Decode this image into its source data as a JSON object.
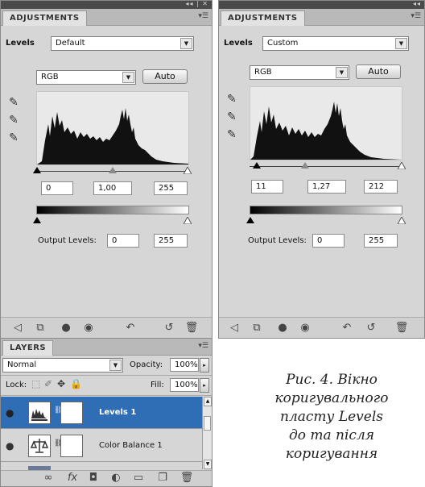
{
  "left_panel": {
    "tab": "ADJUSTMENTS",
    "preset_label": "Levels",
    "preset_value": "Default",
    "channel": "RGB",
    "auto_label": "Auto",
    "input_black": "0",
    "input_gamma": "1,00",
    "input_white": "255",
    "output_label": "Output Levels:",
    "output_black": "0",
    "output_white": "255"
  },
  "right_panel": {
    "tab": "ADJUSTMENTS",
    "preset_label": "Levels",
    "preset_value": "Custom",
    "channel": "RGB",
    "auto_label": "Auto",
    "input_black": "11",
    "input_gamma": "1,27",
    "input_white": "212",
    "output_label": "Output Levels:",
    "output_black": "0",
    "output_white": "255"
  },
  "layers_panel": {
    "tab": "LAYERS",
    "blend_mode": "Normal",
    "opacity_label": "Opacity:",
    "opacity_value": "100%",
    "lock_label": "Lock:",
    "fill_label": "Fill:",
    "fill_value": "100%",
    "layers": [
      {
        "name": "Levels 1",
        "selected": true
      },
      {
        "name": "Color Balance 1",
        "selected": false
      }
    ]
  },
  "caption": {
    "line1": "Рис. 4. Вікно",
    "line2": "коригувального",
    "line3": "пласту Levels",
    "line4": "до та після",
    "line5": "коригування"
  },
  "icons": [
    "eyedropper-black-icon",
    "eyedropper-gray-icon",
    "eyedropper-white-icon",
    "return-arrow-icon",
    "clip-layer-icon",
    "visibility-eye-icon",
    "previous-state-icon",
    "reset-icon",
    "trash-icon",
    "link-icon",
    "fx-icon",
    "mask-icon",
    "adjustment-icon",
    "group-folder-icon",
    "new-layer-icon"
  ],
  "colors": {
    "panel_bg": "#d6d6d6",
    "selected_layer": "#2f6db5"
  }
}
